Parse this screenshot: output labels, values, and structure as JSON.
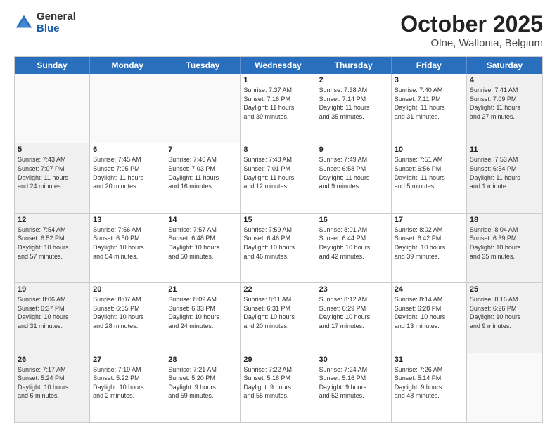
{
  "logo": {
    "general": "General",
    "blue": "Blue"
  },
  "title": "October 2025",
  "subtitle": "Olne, Wallonia, Belgium",
  "days_of_week": [
    "Sunday",
    "Monday",
    "Tuesday",
    "Wednesday",
    "Thursday",
    "Friday",
    "Saturday"
  ],
  "weeks": [
    [
      {
        "day": "",
        "info": ""
      },
      {
        "day": "",
        "info": ""
      },
      {
        "day": "",
        "info": ""
      },
      {
        "day": "1",
        "info": "Sunrise: 7:37 AM\nSunset: 7:16 PM\nDaylight: 11 hours\nand 39 minutes."
      },
      {
        "day": "2",
        "info": "Sunrise: 7:38 AM\nSunset: 7:14 PM\nDaylight: 11 hours\nand 35 minutes."
      },
      {
        "day": "3",
        "info": "Sunrise: 7:40 AM\nSunset: 7:11 PM\nDaylight: 11 hours\nand 31 minutes."
      },
      {
        "day": "4",
        "info": "Sunrise: 7:41 AM\nSunset: 7:09 PM\nDaylight: 11 hours\nand 27 minutes."
      }
    ],
    [
      {
        "day": "5",
        "info": "Sunrise: 7:43 AM\nSunset: 7:07 PM\nDaylight: 11 hours\nand 24 minutes."
      },
      {
        "day": "6",
        "info": "Sunrise: 7:45 AM\nSunset: 7:05 PM\nDaylight: 11 hours\nand 20 minutes."
      },
      {
        "day": "7",
        "info": "Sunrise: 7:46 AM\nSunset: 7:03 PM\nDaylight: 11 hours\nand 16 minutes."
      },
      {
        "day": "8",
        "info": "Sunrise: 7:48 AM\nSunset: 7:01 PM\nDaylight: 11 hours\nand 12 minutes."
      },
      {
        "day": "9",
        "info": "Sunrise: 7:49 AM\nSunset: 6:58 PM\nDaylight: 11 hours\nand 9 minutes."
      },
      {
        "day": "10",
        "info": "Sunrise: 7:51 AM\nSunset: 6:56 PM\nDaylight: 11 hours\nand 5 minutes."
      },
      {
        "day": "11",
        "info": "Sunrise: 7:53 AM\nSunset: 6:54 PM\nDaylight: 11 hours\nand 1 minute."
      }
    ],
    [
      {
        "day": "12",
        "info": "Sunrise: 7:54 AM\nSunset: 6:52 PM\nDaylight: 10 hours\nand 57 minutes."
      },
      {
        "day": "13",
        "info": "Sunrise: 7:56 AM\nSunset: 6:50 PM\nDaylight: 10 hours\nand 54 minutes."
      },
      {
        "day": "14",
        "info": "Sunrise: 7:57 AM\nSunset: 6:48 PM\nDaylight: 10 hours\nand 50 minutes."
      },
      {
        "day": "15",
        "info": "Sunrise: 7:59 AM\nSunset: 6:46 PM\nDaylight: 10 hours\nand 46 minutes."
      },
      {
        "day": "16",
        "info": "Sunrise: 8:01 AM\nSunset: 6:44 PM\nDaylight: 10 hours\nand 42 minutes."
      },
      {
        "day": "17",
        "info": "Sunrise: 8:02 AM\nSunset: 6:42 PM\nDaylight: 10 hours\nand 39 minutes."
      },
      {
        "day": "18",
        "info": "Sunrise: 8:04 AM\nSunset: 6:39 PM\nDaylight: 10 hours\nand 35 minutes."
      }
    ],
    [
      {
        "day": "19",
        "info": "Sunrise: 8:06 AM\nSunset: 6:37 PM\nDaylight: 10 hours\nand 31 minutes."
      },
      {
        "day": "20",
        "info": "Sunrise: 8:07 AM\nSunset: 6:35 PM\nDaylight: 10 hours\nand 28 minutes."
      },
      {
        "day": "21",
        "info": "Sunrise: 8:09 AM\nSunset: 6:33 PM\nDaylight: 10 hours\nand 24 minutes."
      },
      {
        "day": "22",
        "info": "Sunrise: 8:11 AM\nSunset: 6:31 PM\nDaylight: 10 hours\nand 20 minutes."
      },
      {
        "day": "23",
        "info": "Sunrise: 8:12 AM\nSunset: 6:29 PM\nDaylight: 10 hours\nand 17 minutes."
      },
      {
        "day": "24",
        "info": "Sunrise: 8:14 AM\nSunset: 6:28 PM\nDaylight: 10 hours\nand 13 minutes."
      },
      {
        "day": "25",
        "info": "Sunrise: 8:16 AM\nSunset: 6:26 PM\nDaylight: 10 hours\nand 9 minutes."
      }
    ],
    [
      {
        "day": "26",
        "info": "Sunrise: 7:17 AM\nSunset: 5:24 PM\nDaylight: 10 hours\nand 6 minutes."
      },
      {
        "day": "27",
        "info": "Sunrise: 7:19 AM\nSunset: 5:22 PM\nDaylight: 10 hours\nand 2 minutes."
      },
      {
        "day": "28",
        "info": "Sunrise: 7:21 AM\nSunset: 5:20 PM\nDaylight: 9 hours\nand 59 minutes."
      },
      {
        "day": "29",
        "info": "Sunrise: 7:22 AM\nSunset: 5:18 PM\nDaylight: 9 hours\nand 55 minutes."
      },
      {
        "day": "30",
        "info": "Sunrise: 7:24 AM\nSunset: 5:16 PM\nDaylight: 9 hours\nand 52 minutes."
      },
      {
        "day": "31",
        "info": "Sunrise: 7:26 AM\nSunset: 5:14 PM\nDaylight: 9 hours\nand 48 minutes."
      },
      {
        "day": "",
        "info": ""
      }
    ]
  ]
}
